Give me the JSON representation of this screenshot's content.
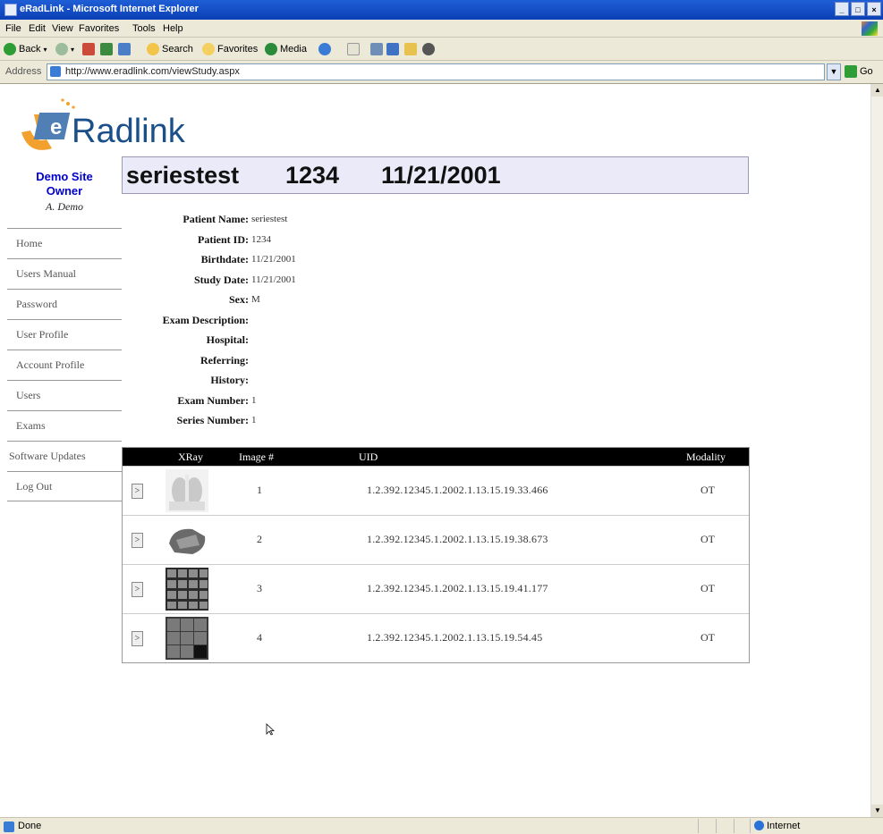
{
  "window": {
    "title": "eRadLink - Microsoft Internet Explorer",
    "controls": [
      "_",
      "□",
      "×"
    ]
  },
  "menu": [
    "File",
    "Edit",
    "View",
    "Favorites",
    "Tools",
    "Help"
  ],
  "toolbar": {
    "back": "Back",
    "search": "Search",
    "favorites": "Favorites",
    "media": "Media"
  },
  "address": {
    "label": "Address",
    "url": "http://www.eradlink.com/viewStudy.aspx",
    "go": "Go"
  },
  "status": {
    "text": "Done",
    "zone": "Internet"
  },
  "logo": {
    "text": "Radlink",
    "badge": "e"
  },
  "user": {
    "site": "Demo Site Owner",
    "name": "A. Demo"
  },
  "nav": [
    "Home",
    "Users Manual",
    "Password",
    "User Profile",
    "Account Profile",
    "Users",
    "Exams",
    "Software Updates",
    "Log Out"
  ],
  "study": {
    "patient": "seriestest",
    "id": "1234",
    "date": "11/21/2001"
  },
  "patient_info": [
    {
      "label": "Patient Name:",
      "value": "seriestest"
    },
    {
      "label": "Patient ID:",
      "value": "1234"
    },
    {
      "label": "Birthdate:",
      "value": "11/21/2001"
    },
    {
      "label": "Study Date:",
      "value": "11/21/2001"
    },
    {
      "label": "Sex:",
      "value": "M"
    },
    {
      "label": "Exam Description:",
      "value": ""
    },
    {
      "label": "Hospital:",
      "value": ""
    },
    {
      "label": "Referring:",
      "value": ""
    },
    {
      "label": "History:",
      "value": ""
    },
    {
      "label": "Exam Number:",
      "value": "1"
    },
    {
      "label": "Series Number:",
      "value": "1"
    }
  ],
  "table": {
    "headers": [
      "XRay",
      "Image #",
      "UID",
      "Modality"
    ],
    "rows": [
      {
        "btn": ">",
        "image": "1",
        "uid": "1.2.392.12345.1.2002.1.13.15.19.33.466",
        "modality": "OT"
      },
      {
        "btn": ">",
        "image": "2",
        "uid": "1.2.392.12345.1.2002.1.13.15.19.38.673",
        "modality": "OT"
      },
      {
        "btn": ">",
        "image": "3",
        "uid": "1.2.392.12345.1.2002.1.13.15.19.41.177",
        "modality": "OT"
      },
      {
        "btn": ">",
        "image": "4",
        "uid": "1.2.392.12345.1.2002.1.13.15.19.54.45",
        "modality": "OT"
      }
    ]
  }
}
